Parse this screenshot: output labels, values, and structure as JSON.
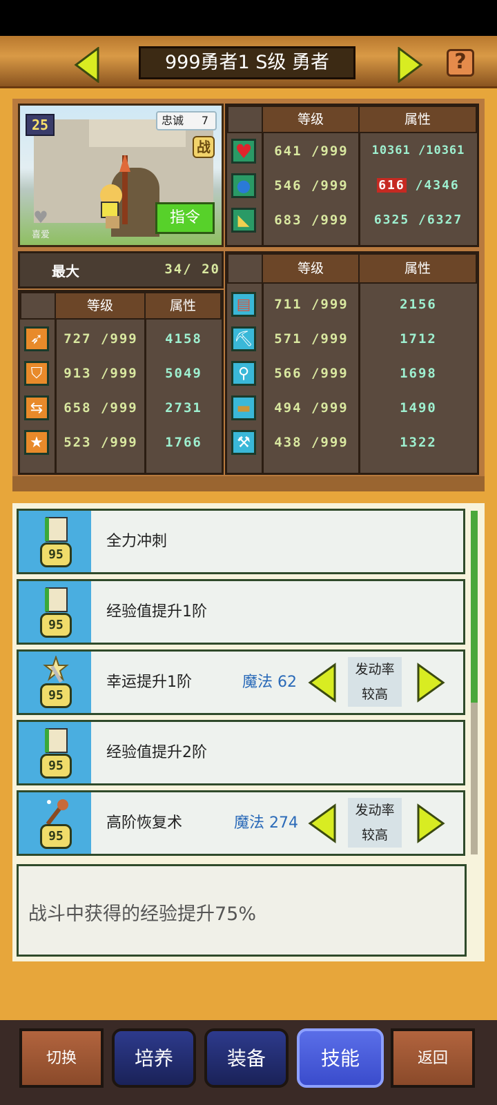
{
  "header": {
    "title": "999勇者1 S级 勇者",
    "help_label": "?"
  },
  "portrait": {
    "level": "25",
    "loyalty_label": "忠诚",
    "loyalty_value": "7",
    "battle_label": "战",
    "command_label": "指令",
    "like_label": "喜爱"
  },
  "vitals": {
    "headers": [
      "等级",
      "属性"
    ],
    "rows": [
      {
        "icon": "heart-icon",
        "level": "641 /999",
        "attr": "10361 /10361"
      },
      {
        "icon": "potion-icon",
        "level": "546 /999",
        "attr_red": "616",
        "attr_rest": " /4346"
      },
      {
        "icon": "muscle-icon",
        "level": "683 /999",
        "attr": "6325 /6327"
      }
    ]
  },
  "capacity": {
    "label": "最大",
    "value": "34/  20"
  },
  "combat": {
    "headers": [
      "等级",
      "属性"
    ],
    "rows": [
      {
        "icon": "sword-icon",
        "level": "727 /999",
        "attr": "4158"
      },
      {
        "icon": "shield-icon",
        "level": "913 /999",
        "attr": "5049"
      },
      {
        "icon": "dodge-icon",
        "level": "658 /999",
        "attr": "2731"
      },
      {
        "icon": "star-icon",
        "level": "523 /999",
        "attr": "1766"
      }
    ]
  },
  "work": {
    "headers": [
      "等级",
      "属性"
    ],
    "rows": [
      {
        "icon": "book-icon",
        "level": "711 /999",
        "attr": "2156"
      },
      {
        "icon": "pickaxe-icon",
        "level": "571 /999",
        "attr": "1712"
      },
      {
        "icon": "shovel-icon",
        "level": "566 /999",
        "attr": "1698"
      },
      {
        "icon": "anvil-icon",
        "level": "494 /999",
        "attr": "1490"
      },
      {
        "icon": "hammer-icon",
        "level": "438 /999",
        "attr": "1322"
      }
    ]
  },
  "skills": [
    {
      "name": "全力冲刺",
      "level": "95",
      "icon": "scroll-icon"
    },
    {
      "name": "经验值提升1阶",
      "level": "95",
      "icon": "scroll-icon"
    },
    {
      "name": "幸运提升1阶",
      "level": "95",
      "icon": "lucky-sword-icon",
      "magic": "魔法 62",
      "rate_line1": "发动率",
      "rate_line2": "较高"
    },
    {
      "name": "经验值提升2阶",
      "level": "95",
      "icon": "scroll-icon"
    },
    {
      "name": "高阶恢复术",
      "level": "95",
      "icon": "staff-icon",
      "magic": "魔法 274",
      "rate_line1": "发动率",
      "rate_line2": "较高"
    }
  ],
  "description": "战斗中获得的经验提升75%",
  "bottom_nav": {
    "switch": "切换",
    "train": "培养",
    "equip": "装备",
    "skill": "技能",
    "back": "返回"
  },
  "colors": {
    "background": "#e7a63b",
    "table_header": "#6c4628",
    "skill_icon_bg": "#4aaee0",
    "active_tab": "#3a4ccc"
  }
}
